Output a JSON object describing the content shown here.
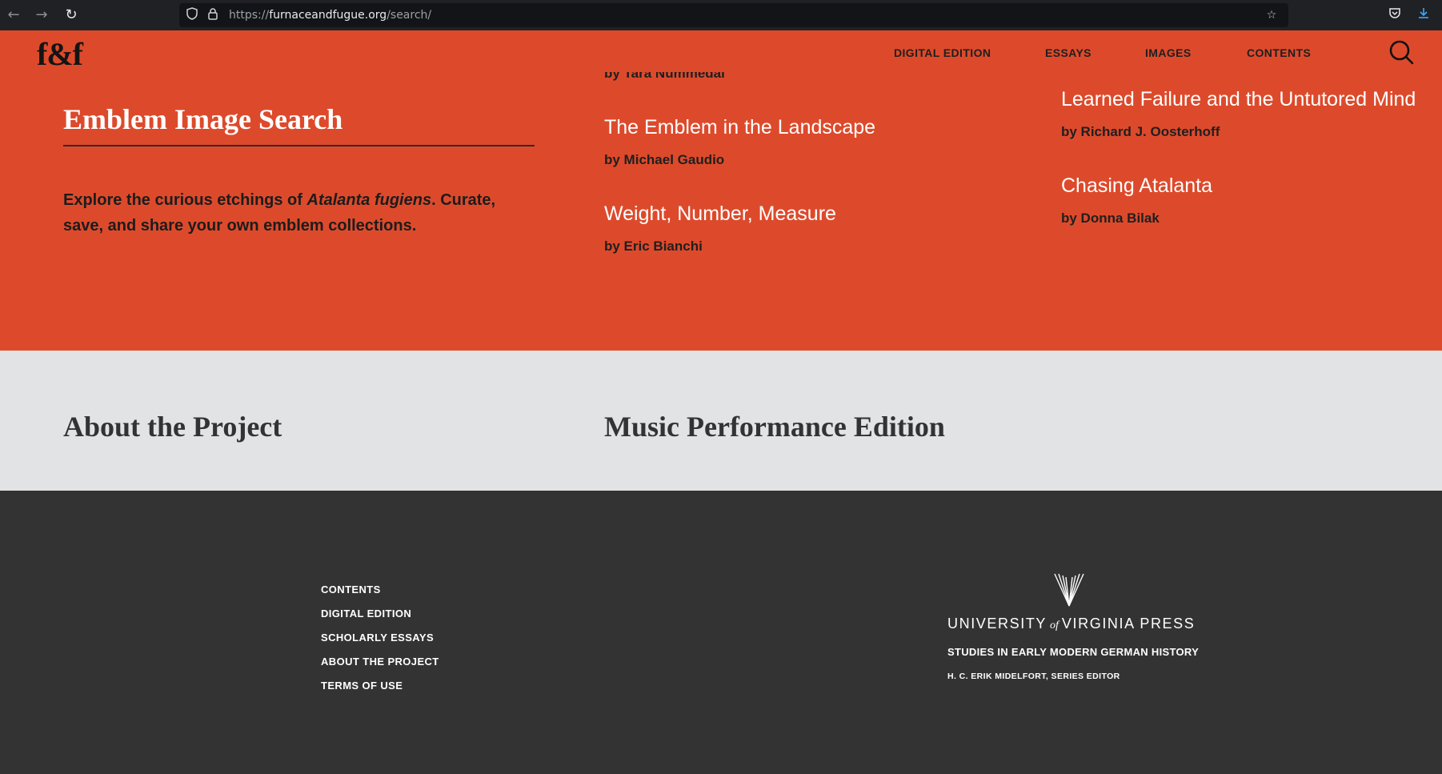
{
  "browser": {
    "url_prefix": "https://",
    "url_domain": "furnaceandfugue.org",
    "url_path": "/search/",
    "back_icon": "arrow-left-icon",
    "forward_icon": "arrow-right-icon",
    "reload_icon": "reload-icon",
    "shield_icon": "shield-icon",
    "lock_icon": "lock-icon",
    "star_icon": "star-icon",
    "pocket_icon": "pocket-icon",
    "download_icon": "download-icon"
  },
  "site": {
    "logo": "f&f",
    "nav": [
      "DIGITAL EDITION",
      "ESSAYS",
      "IMAGES",
      "CONTENTS"
    ],
    "accent_color": "#dd4a2b"
  },
  "hero": {
    "title": "Emblem Image Search",
    "desc_before": "Explore the curious etchings of ",
    "desc_italic": "Atalanta fugiens",
    "desc_after": ". Curate, save, and share your own emblem collections."
  },
  "essays": [
    {
      "title": "",
      "author": "by Tara Nummedal"
    },
    {
      "title": "The Emblem in the Landscape",
      "author": "by Michael Gaudio"
    },
    {
      "title": "Weight, Number, Measure",
      "author": "by Eric Bianchi"
    },
    {
      "title": "Learned Failure and the Untutored Mind",
      "author": "by Richard J. Oosterhoff"
    },
    {
      "title": "Chasing Atalanta",
      "author": "by Donna Bilak"
    }
  ],
  "sections": {
    "about": "About the Project",
    "music": "Music Performance Edition"
  },
  "footer": {
    "links": [
      "CONTENTS",
      "DIGITAL EDITION",
      "SCHOLARLY ESSAYS",
      "ABOUT THE PROJECT",
      "TERMS OF USE"
    ],
    "press_left": "UNIVERSITY",
    "press_of": "of",
    "press_right": "VIRGINIA PRESS",
    "series": "STUDIES IN EARLY MODERN GERMAN HISTORY",
    "editor": "H. C. ERIK MIDELFORT, SERIES EDITOR"
  }
}
